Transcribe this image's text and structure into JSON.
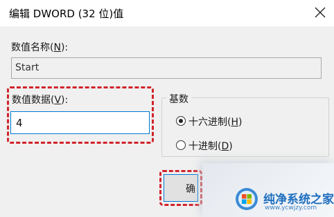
{
  "window": {
    "title": "编辑 DWORD (32 位)值",
    "close_icon": "close-icon"
  },
  "value_name": {
    "label_prefix": "数值名称(",
    "label_key": "N",
    "label_suffix": "):",
    "value": "Start"
  },
  "value_data": {
    "label_prefix": "数值数据(",
    "label_key": "V",
    "label_suffix": "):",
    "value": "4"
  },
  "base": {
    "legend": "基数",
    "options": [
      {
        "prefix": "十六进制(",
        "key": "H",
        "suffix": ")",
        "selected": true
      },
      {
        "prefix": "十进制(",
        "key": "D",
        "suffix": ")",
        "selected": false
      }
    ]
  },
  "ok_button": {
    "label": "确"
  },
  "watermark": {
    "title": "纯净系统之家",
    "url": "www.ycwjzy.com"
  },
  "colors": {
    "highlight": "#d1232a",
    "focus_border": "#0078d7",
    "watermark_text": "#1f6fc0"
  }
}
